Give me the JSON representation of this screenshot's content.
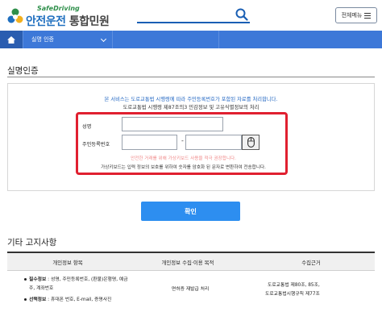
{
  "header": {
    "logo_en": "SafeDriving",
    "logo_main": "안전운전",
    "logo_sub": "통합민원",
    "menu_label": "전체메뉴"
  },
  "nav": {
    "breadcrumb": "실명 인증"
  },
  "page": {
    "title": "실명인증"
  },
  "form": {
    "notice_blue": "본 서비스는 도로교통법 시행령에 따라 주민등록번호가 포함된 자료를 처리합니다.",
    "notice_black": "도로교통법 시행령 제87조의3 민감정보 및 고유식별정보의 처리",
    "name_label": "성명",
    "name_value": "",
    "rrn_label": "주민등록번호",
    "rrn_front_value": "",
    "rrn_dash": "-",
    "rrn_back_value": "",
    "warning": "안전한 거래를 위해 가상키보드 사용을 적극 권장합니다.",
    "keyboard_info": "가상키보드는 입력 정보의 보호를 위하여 숫자를 암호화 된 문자로 변환하여 전송합니다.",
    "confirm_label": "확인"
  },
  "notices": {
    "title": "기타 고지사항",
    "columns": [
      "개인정보 항목",
      "개인정보 수집·이용 목적",
      "수집근거"
    ],
    "required_label": "필수정보",
    "required_text_1": " : 성명, 주민등록번호, (환불)은행명, 예금",
    "required_text_2": "주, 계좌번호",
    "optional_label": "선택정보",
    "optional_text": " : 휴대폰 번호, E-mail, 증명사진",
    "purpose": "면허증 재발급 처리",
    "basis_1": "도로교통법 제80조, 85조,",
    "basis_2": "도로교통법시행규칙 제77조"
  },
  "colors": {
    "brand_blue": "#3d78d8",
    "confirm_blue": "#2d8ef0",
    "highlight_red": "#e02030",
    "logo_green": "#2e8f4a"
  },
  "icons": [
    "logo-mark-icon",
    "search-icon",
    "hamburger-icon",
    "home-icon",
    "chevron-down-icon",
    "mouse-icon"
  ]
}
